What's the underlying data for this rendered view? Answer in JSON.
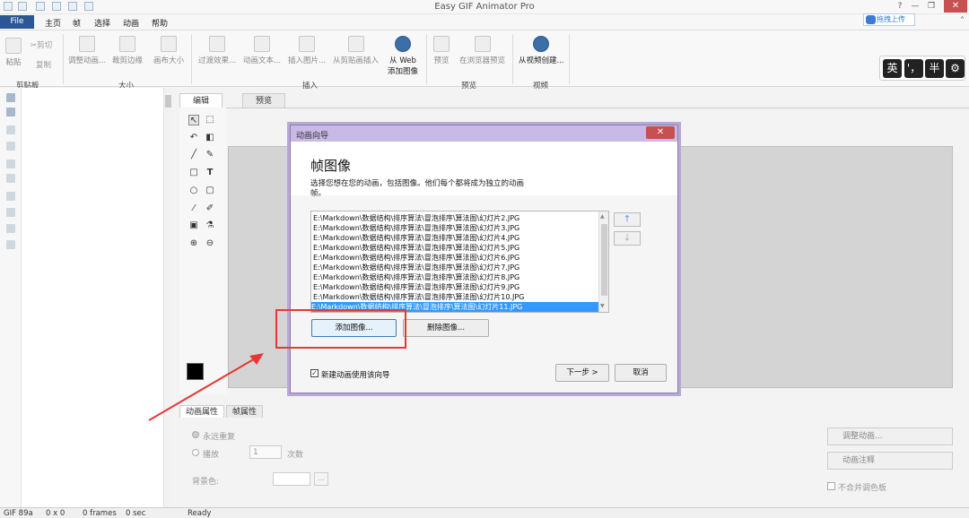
{
  "window": {
    "title": "Easy GIF Animator Pro",
    "close": "✕",
    "minimize": "—",
    "restore": "❐",
    "help": "?"
  },
  "menu": {
    "file": "File",
    "items": [
      "主页",
      "帧",
      "选择",
      "动画",
      "帮助"
    ],
    "upload": "拖拽上传"
  },
  "ribbon": {
    "clipboard": {
      "paste": "粘贴",
      "cut": "✂剪切",
      "copy": "复制",
      "group": "剪贴板"
    },
    "size": {
      "resize": "调整动画...",
      "crop": "裁剪边缘",
      "canvas": "画布大小",
      "group": "大小"
    },
    "insert": {
      "transition": "过渡效果...",
      "text": "动画文本...",
      "image": "插入图片...",
      "clipboard": "从剪贴画插入",
      "web_line1": "从 Web",
      "web_line2": "添加图像",
      "group": "插入"
    },
    "preview": {
      "preview": "预览",
      "browser": "在浏览器预览",
      "group": "预览"
    },
    "video": {
      "create": "从视频创建...",
      "group": "视频"
    }
  },
  "ime": [
    "英",
    "'，",
    "半",
    "⚙"
  ],
  "editor_tabs": [
    "编辑",
    "预览"
  ],
  "tools": [
    "↖",
    "⬚",
    "↶",
    "◧",
    "╱",
    "✎",
    "□",
    "T",
    "○",
    "▢",
    "⁄",
    "✐",
    "▣",
    "⚗",
    "⊕",
    "⊖"
  ],
  "dialog": {
    "title": "动画向导",
    "close": "✕",
    "heading": "帧图像",
    "description": "选择您想在您的动画，包括图像。他们每个都将成为独立的动画帧。",
    "files": [
      "E:\\Markdown\\数据结构\\排序算法\\冒泡排序\\算法图\\幻灯片2.JPG",
      "E:\\Markdown\\数据结构\\排序算法\\冒泡排序\\算法图\\幻灯片3.JPG",
      "E:\\Markdown\\数据结构\\排序算法\\冒泡排序\\算法图\\幻灯片4.JPG",
      "E:\\Markdown\\数据结构\\排序算法\\冒泡排序\\算法图\\幻灯片5.JPG",
      "E:\\Markdown\\数据结构\\排序算法\\冒泡排序\\算法图\\幻灯片6.JPG",
      "E:\\Markdown\\数据结构\\排序算法\\冒泡排序\\算法图\\幻灯片7.JPG",
      "E:\\Markdown\\数据结构\\排序算法\\冒泡排序\\算法图\\幻灯片8.JPG",
      "E:\\Markdown\\数据结构\\排序算法\\冒泡排序\\算法图\\幻灯片9.JPG",
      "E:\\Markdown\\数据结构\\排序算法\\冒泡排序\\算法图\\幻灯片10.JPG",
      "E:\\Markdown\\数据结构\\排序算法\\冒泡排序\\算法图\\幻灯片11.JPG"
    ],
    "selected_index": 9,
    "move_up": "🡑",
    "move_down": "🡓",
    "add_image": "添加图像...",
    "delete_image": "删除图像...",
    "checkbox_label": "新建动画使用该向导",
    "checkbox_checked": true,
    "next": "下一步 >",
    "cancel": "取消"
  },
  "properties": {
    "tabs": [
      "动画属性",
      "帧属性"
    ],
    "loop_forever": "永远重复",
    "play": "播放",
    "play_count": "1",
    "times": "次数",
    "bg_color": "背景色:",
    "browse": "...",
    "adjust": "调整动画...",
    "comment": "动画注释",
    "no_merge": "不合并调色板"
  },
  "status": {
    "format": "GIF 89a",
    "size": "0 x 0",
    "frames": "0 frames",
    "duration": "0 sec",
    "state": "Ready"
  },
  "colors": {
    "accent": "#2b5797",
    "dialog_title": "#c8b9e6",
    "selection": "#3399ff",
    "annotation": "#e53935"
  }
}
